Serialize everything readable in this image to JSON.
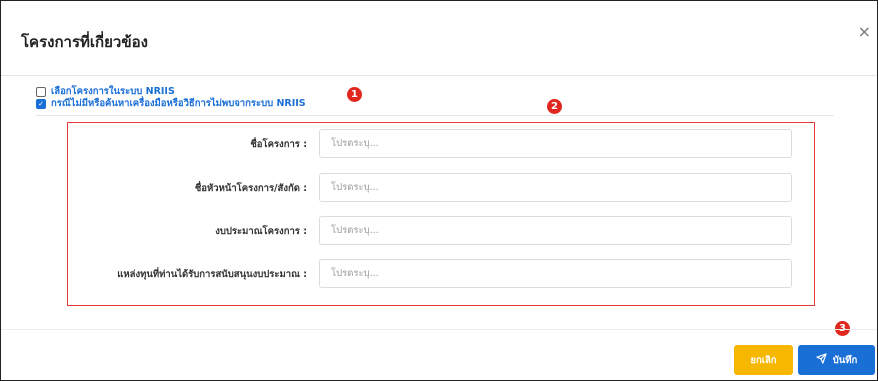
{
  "modal": {
    "title": "โครงการที่เกี่ยวข้อง",
    "close_symbol": "×"
  },
  "options": [
    {
      "label": "เลือกโครงการในระบบ NRIIS",
      "checked": false
    },
    {
      "label": "กรณีไม่มีหรือค้นหาเครื่องมือหรือวิธีการไม่พบจากระบบ NRIIS",
      "checked": true
    }
  ],
  "markers": [
    "1",
    "2",
    "3"
  ],
  "form": {
    "fields": [
      {
        "label": "ชื่อโครงการ :",
        "placeholder": "โปรดระบุ..."
      },
      {
        "label": "ชื่อหัวหน้าโครงการ/สังกัด :",
        "placeholder": "โปรดระบุ..."
      },
      {
        "label": "งบประมาณโครงการ :",
        "placeholder": "โปรดระบุ..."
      },
      {
        "label": "แหล่งทุนที่ท่านได้รับการสนับสนุนงบประมาณ :",
        "placeholder": "โปรดระบุ..."
      }
    ]
  },
  "footer": {
    "cancel_label": "ยกเลิก",
    "save_label": "บันทึก"
  },
  "colors": {
    "accent": "#1a6fd6",
    "cancel": "#f5b700",
    "marker": "#e0281f",
    "highlight_box": "#e23a3a"
  },
  "icons": {
    "close": "close-icon",
    "save": "send-icon"
  }
}
